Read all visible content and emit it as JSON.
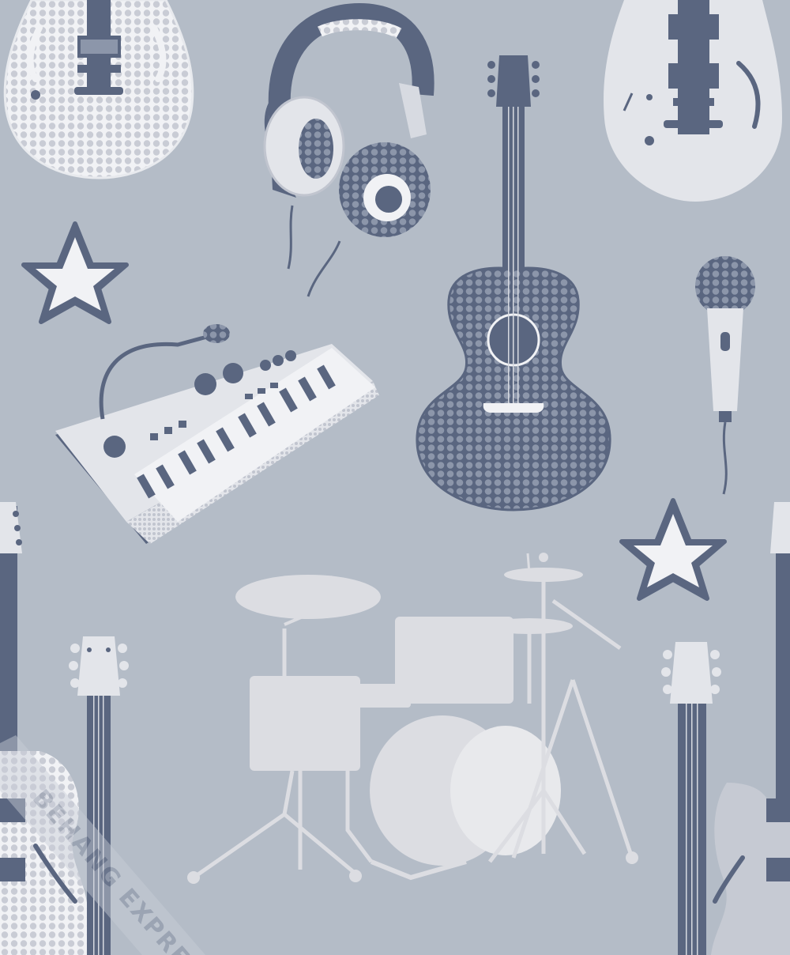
{
  "wallpaper": {
    "theme": "music-instruments-pattern",
    "background_color": "#b4bcc7",
    "colors": {
      "navy": "#5a6680",
      "light": "#e3e5ea",
      "white": "#f1f2f5",
      "mid": "#c6cad3",
      "silhouette": "#dcdde2"
    },
    "watermark": {
      "text": "BEHANG EXPRESS"
    },
    "items": [
      "electric-guitar",
      "headphones",
      "acoustic-guitar",
      "electric-guitar",
      "star",
      "microphone",
      "synthesizer-keyboard",
      "star",
      "drum-kit",
      "guitar",
      "guitar",
      "guitar"
    ]
  }
}
